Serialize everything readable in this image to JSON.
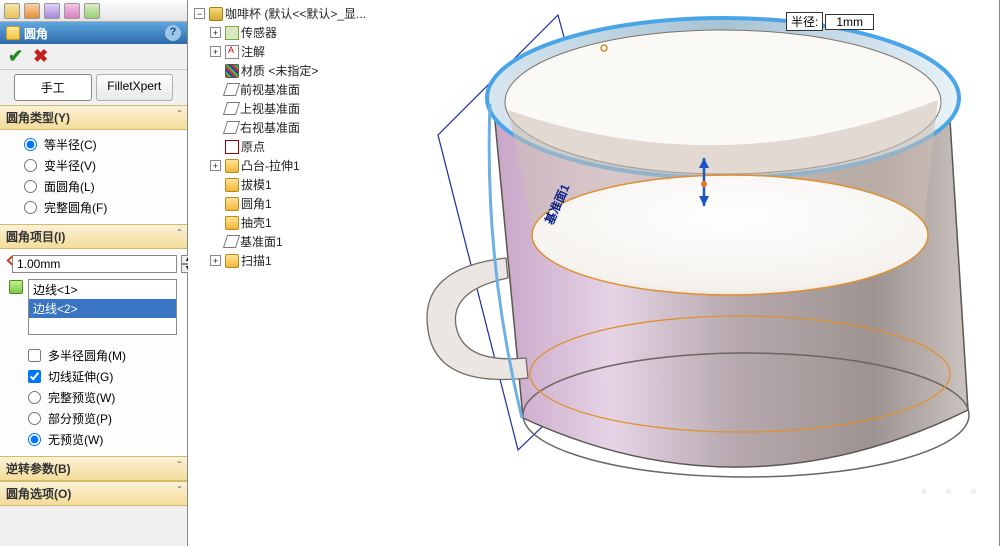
{
  "panel": {
    "title": "圆角",
    "tab_manual": "手工",
    "tab_xpert": "FilletXpert",
    "sec_type": "圆角类型(Y)",
    "type_opts": {
      "eq": "等半径(C)",
      "var": "变半径(V)",
      "face": "面圆角(L)",
      "full": "完整圆角(F)"
    },
    "sec_items": "圆角项目(I)",
    "radius_value": "1.00mm",
    "edge_list": [
      "边线<1>",
      "边线<2>"
    ],
    "multi_radius": "多半径圆角(M)",
    "tan_prop": "切线延伸(G)",
    "preview_opts": {
      "full": "完整预览(W)",
      "part": "部分预览(P)",
      "none": "无预览(W)"
    },
    "sec_reverse": "逆转参数(B)",
    "sec_options": "圆角选项(O)"
  },
  "tree": {
    "root": "咖啡杯  (默认<<默认>_显...",
    "sensor": "传感器",
    "annot": "注解",
    "material": "材质 <未指定>",
    "plane_front": "前视基准面",
    "plane_top": "上视基准面",
    "plane_right": "右视基准面",
    "origin": "原点",
    "f_bossextr": "凸台-拉伸1",
    "f_draft": "拔模1",
    "f_fillet": "圆角1",
    "f_shell": "抽壳1",
    "f_refplane": "基准面1",
    "f_sweep": "扫描1"
  },
  "viewport": {
    "radius_label": "半径:",
    "radius_value": "1mm",
    "plane_annotation": "基准面1"
  }
}
